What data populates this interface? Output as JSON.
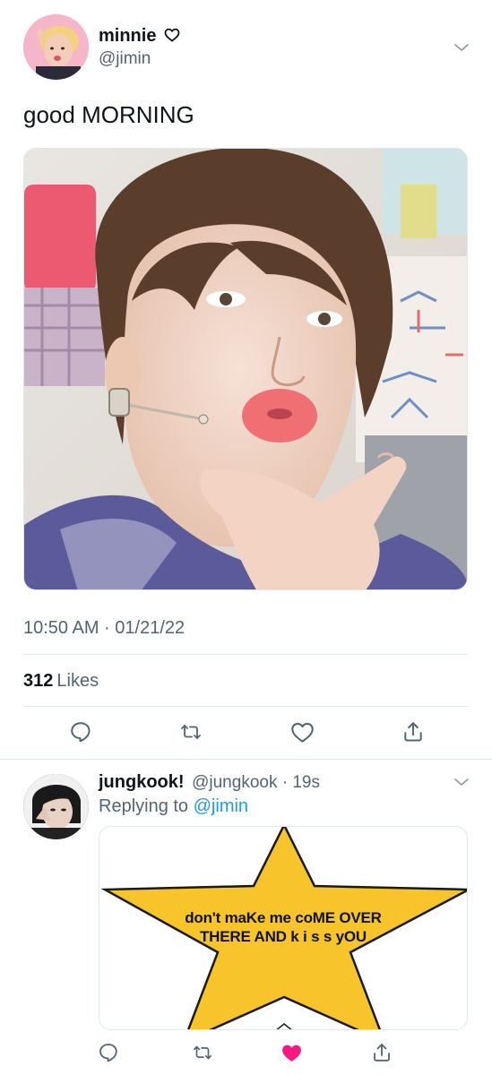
{
  "main_tweet": {
    "display_name": "minnie",
    "handle": "@jimin",
    "text": "good MORNING",
    "timestamp": "10:50 AM · 01/21/22",
    "likes_count": "312",
    "likes_label": "Likes"
  },
  "reply_tweet": {
    "display_name": "jungkook!",
    "handle_time": "@jungkook · 19s",
    "replying_prefix": "Replying to",
    "replying_mention": "@jimin",
    "star_text_line1": "don't maKe me coME OVER",
    "star_text_line2": "THERE AND k i s s yOU",
    "liked": true
  },
  "icons": {
    "reply": "speech-bubble-icon",
    "retweet": "retweet-icon",
    "like": "heart-icon",
    "share": "share-icon",
    "more": "chevron-down-icon",
    "badge": "heart-outline-icon"
  },
  "colors": {
    "like_active": "#f91880",
    "link": "#1d9bf0",
    "secondary": "#536471",
    "star": "#f7c52b"
  }
}
